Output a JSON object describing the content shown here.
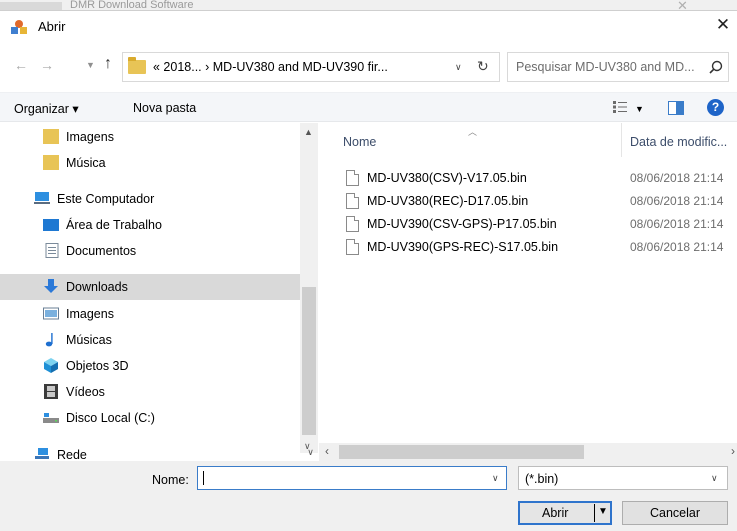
{
  "background_window": {
    "title": "DMR Download Software"
  },
  "dialog": {
    "title": "Abrir",
    "close_glyph": "✕"
  },
  "navigation": {
    "back_glyph": "←",
    "forward_glyph": "→",
    "recent_glyph": "⌄",
    "up_glyph": "↑",
    "address_path": "« 2018...  ›  MD-UV380 and MD-UV390 fir...",
    "refresh_glyph": "↻",
    "search_placeholder": "Pesquisar MD-UV380 and MD..."
  },
  "toolbar": {
    "organize_label": "Organizar ▾",
    "new_folder_label": "Nova pasta",
    "help_label": "?"
  },
  "sidebar": {
    "items": [
      {
        "label": "Imagens",
        "icon": "folder-icon"
      },
      {
        "label": "Música",
        "icon": "folder-icon"
      },
      {
        "label": "Este Computador",
        "icon": "computer-icon"
      },
      {
        "label": "Área de Trabalho",
        "icon": "desktop-icon"
      },
      {
        "label": "Documentos",
        "icon": "documents-icon"
      },
      {
        "label": "Downloads",
        "icon": "download-icon",
        "selected": true
      },
      {
        "label": "Imagens",
        "icon": "pictures-icon"
      },
      {
        "label": "Músicas",
        "icon": "music-note-icon"
      },
      {
        "label": "Objetos 3D",
        "icon": "cube-icon"
      },
      {
        "label": "Vídeos",
        "icon": "film-icon"
      },
      {
        "label": "Disco Local (C:)",
        "icon": "drive-icon"
      },
      {
        "label": "Rede",
        "icon": "network-icon"
      }
    ]
  },
  "files": {
    "columns": {
      "name": "Nome",
      "date": "Data de modific..."
    },
    "rows": [
      {
        "name": "MD-UV380(CSV)-V17.05.bin",
        "date": "08/06/2018 21:14"
      },
      {
        "name": "MD-UV380(REC)-D17.05.bin",
        "date": "08/06/2018 21:14"
      },
      {
        "name": "MD-UV390(CSV-GPS)-P17.05.bin",
        "date": "08/06/2018 21:14"
      },
      {
        "name": "MD-UV390(GPS-REC)-S17.05.bin",
        "date": "08/06/2018 21:14"
      }
    ]
  },
  "footer": {
    "name_label": "Nome:",
    "name_value": "",
    "filter_value": "(*.bin)",
    "open_label": "Abrir",
    "cancel_label": "Cancelar"
  },
  "colors": {
    "accent": "#2f74cc",
    "selection": "#d9d9d9",
    "folder": "#e8c456"
  }
}
